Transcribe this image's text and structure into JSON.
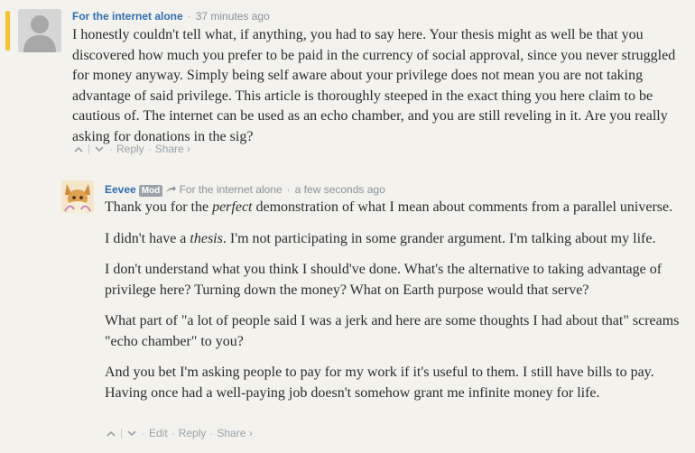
{
  "comment1": {
    "author": "For the internet alone",
    "bullet": "·",
    "time": "37 minutes ago",
    "text": "I honestly couldn't tell what, if anything, you had to say here. Your thesis might as well be that you discovered how much you prefer to be paid in the currency of social approval, since you never struggled for money anyway. Simply being self aware about your privilege does not mean you are not taking advantage of said privilege. This article is thoroughly steeped in the exact thing you here claim to be cautious of. The internet can be used as an echo chamber, and you are still reveling in it. Are you really asking for donations in the sig?",
    "actions": {
      "upvote": "^",
      "downvote": "v",
      "reply": "Reply",
      "share": "Share ›",
      "dot": "·"
    }
  },
  "comment2": {
    "author": "Eevee",
    "badge": "Mod",
    "reply_to": "For the internet alone",
    "bullet": "·",
    "time": "a few seconds ago",
    "paragraphs": {
      "p1_before": "Thank you for the ",
      "p1_em": "perfect",
      "p1_after": " demonstration of what I mean about comments from a parallel universe.",
      "p2_before": "I didn't have a ",
      "p2_em": "thesis",
      "p2_after": ". I'm not participating in some grander argument. I'm talking about my life.",
      "p3": "I don't understand what you think I should've done. What's the alternative to taking advantage of privilege here? Turning down the money? What on Earth purpose would that serve?",
      "p4": "What part of \"a lot of people said I was a jerk and here are some thoughts I had about that\" screams \"echo chamber\" to you?",
      "p5": "And you bet I'm asking people to pay for my work if it's useful to them. I still have bills to pay. Having once had a well-paying job doesn't somehow grant me infinite money for life."
    },
    "actions": {
      "upvote": "^",
      "downvote": "v",
      "edit": "Edit",
      "reply": "Reply",
      "share": "Share ›",
      "dot": "·"
    }
  },
  "colors": {
    "accent_bar": "#f7c32e",
    "author_link": "#2e6fb5",
    "meta_gray": "#8a9399",
    "background": "#f3f2ed"
  },
  "icons": {
    "reply_arrow": "reply-arrow-icon",
    "default_avatar": "user-silhouette-icon",
    "eevee_avatar": "eevee-avatar-icon"
  }
}
